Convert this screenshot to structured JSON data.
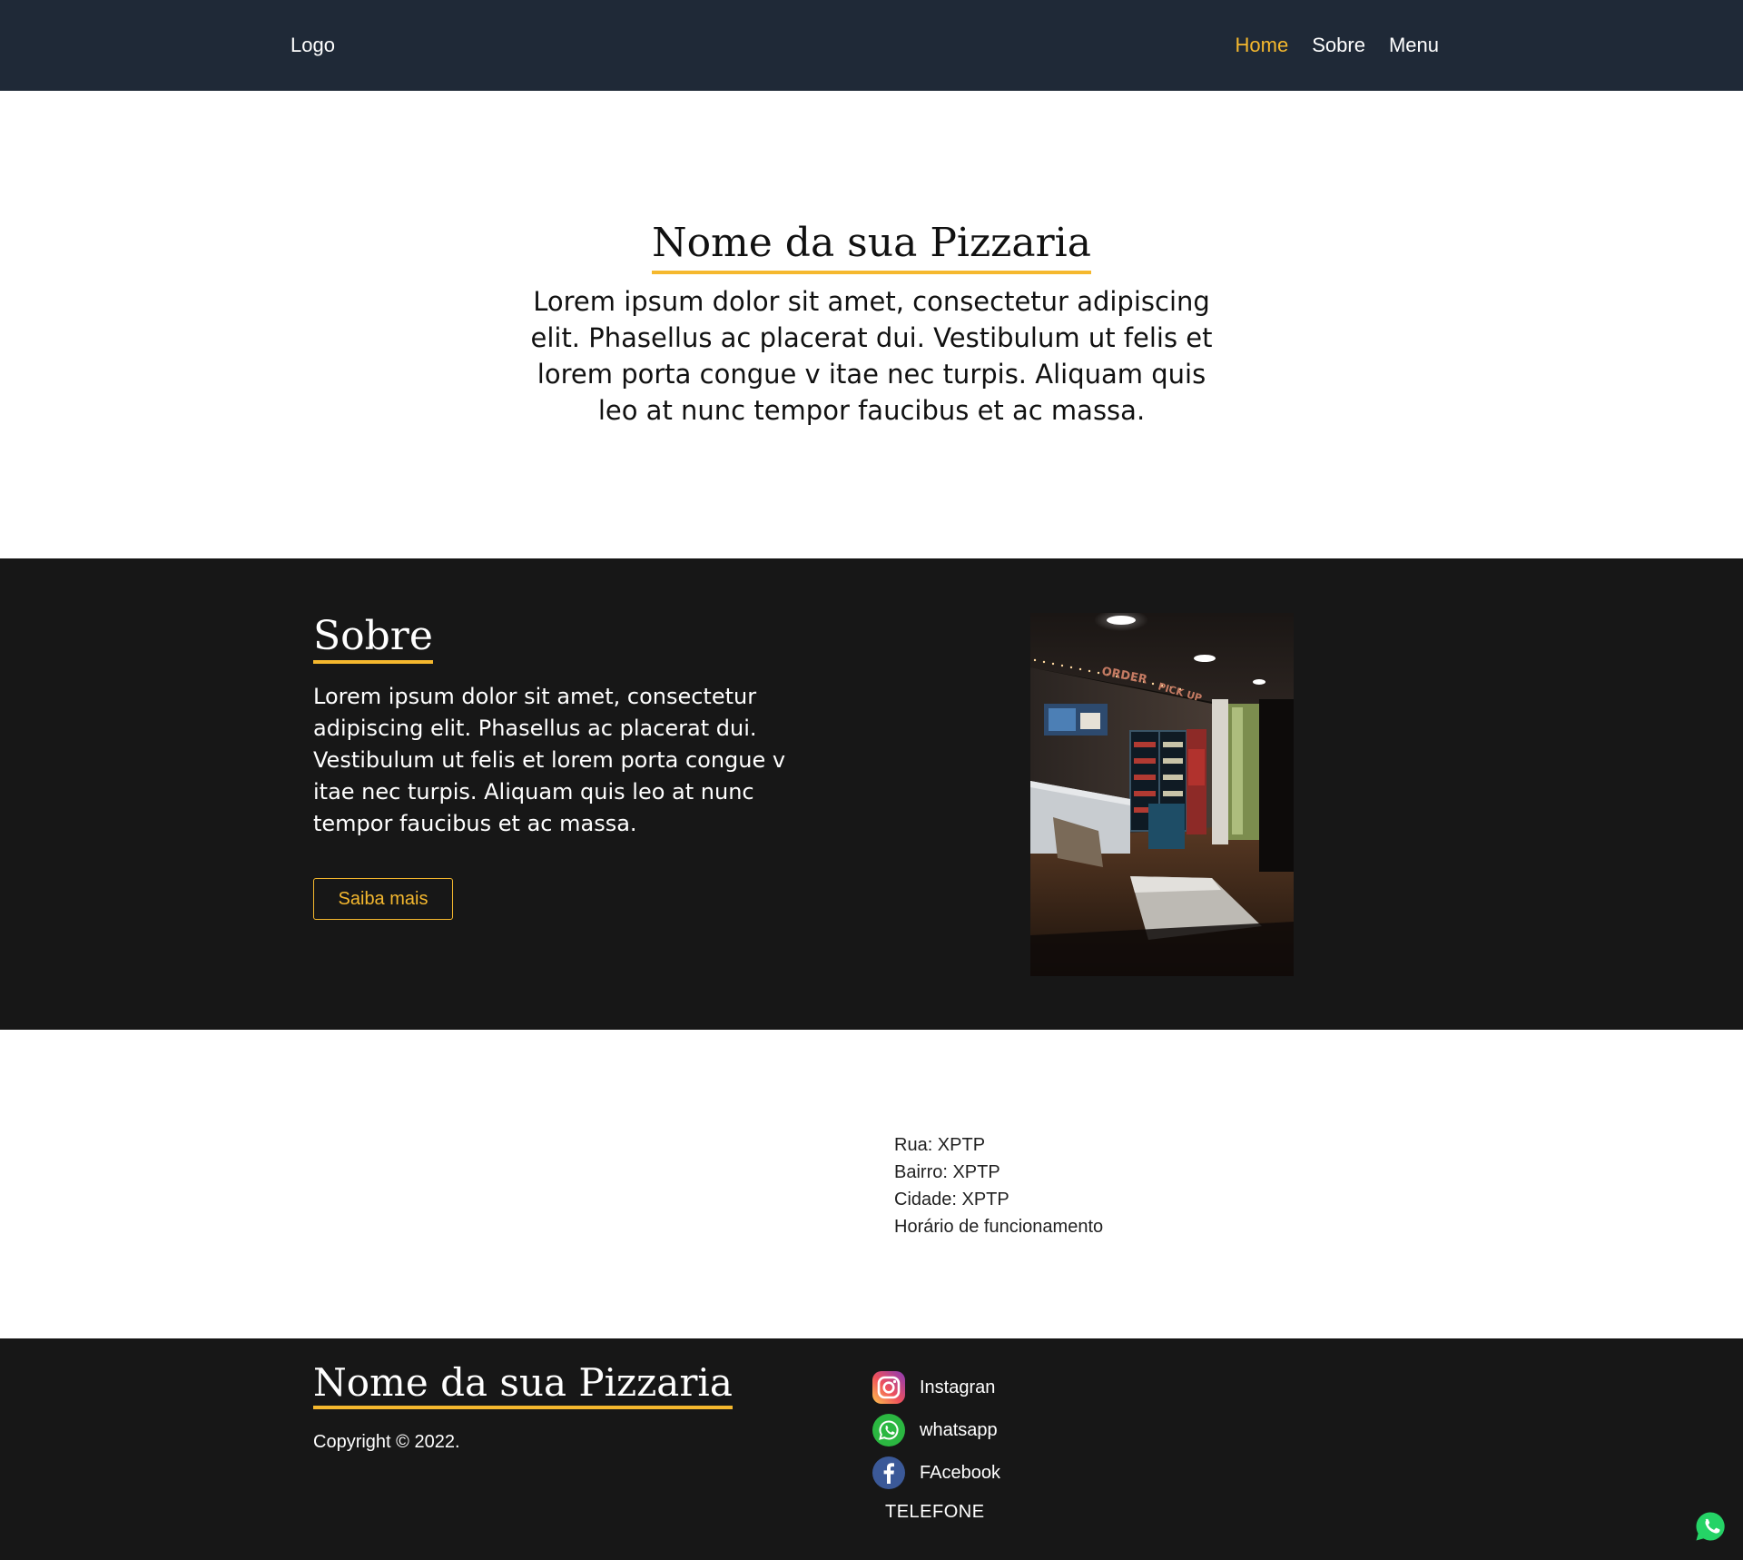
{
  "header": {
    "logo": "Logo",
    "nav": [
      {
        "label": "Home",
        "active": true
      },
      {
        "label": "Sobre",
        "active": false
      },
      {
        "label": "Menu",
        "active": false
      }
    ]
  },
  "hero": {
    "title": "Nome da sua Pizzaria",
    "text": "Lorem ipsum dolor sit amet, consectetur adipiscing elit. Phasellus ac placerat dui. Vestibulum ut felis et lorem porta congue v itae nec turpis. Aliquam quis leo at nunc tempor faucibus et ac massa."
  },
  "sobre": {
    "title": "Sobre",
    "text": "Lorem ipsum dolor sit amet, consectetur adipiscing elit. Phasellus ac placerat dui. Vestibulum ut felis et lorem porta congue v itae nec turpis. Aliquam quis leo at nunc tempor faucibus et ac massa.",
    "button": "Saiba mais",
    "photo_signs": [
      "ORDER",
      "PICK UP"
    ]
  },
  "address": {
    "rua": "Rua: XPTP",
    "bairro": "Bairro: XPTP",
    "cidade": "Cidade: XPTP",
    "horario": "Horário de funcionamento"
  },
  "footer": {
    "title": "Nome da sua Pizzaria",
    "copyright": "Copyright © 2022.",
    "social": [
      {
        "label": "Instagran",
        "icon": "instagram-icon"
      },
      {
        "label": "whatsapp",
        "icon": "whatsapp-icon"
      },
      {
        "label": "FAcebook",
        "icon": "facebook-icon"
      }
    ],
    "telefone": "TELEFONE"
  },
  "colors": {
    "accent": "#f5b82e",
    "header_bg": "#1f2937",
    "section_dark_bg": "#171717",
    "whatsapp_green": "#25d366",
    "facebook_blue": "#3b5998"
  },
  "floating": {
    "icon": "whatsapp-float-icon"
  }
}
